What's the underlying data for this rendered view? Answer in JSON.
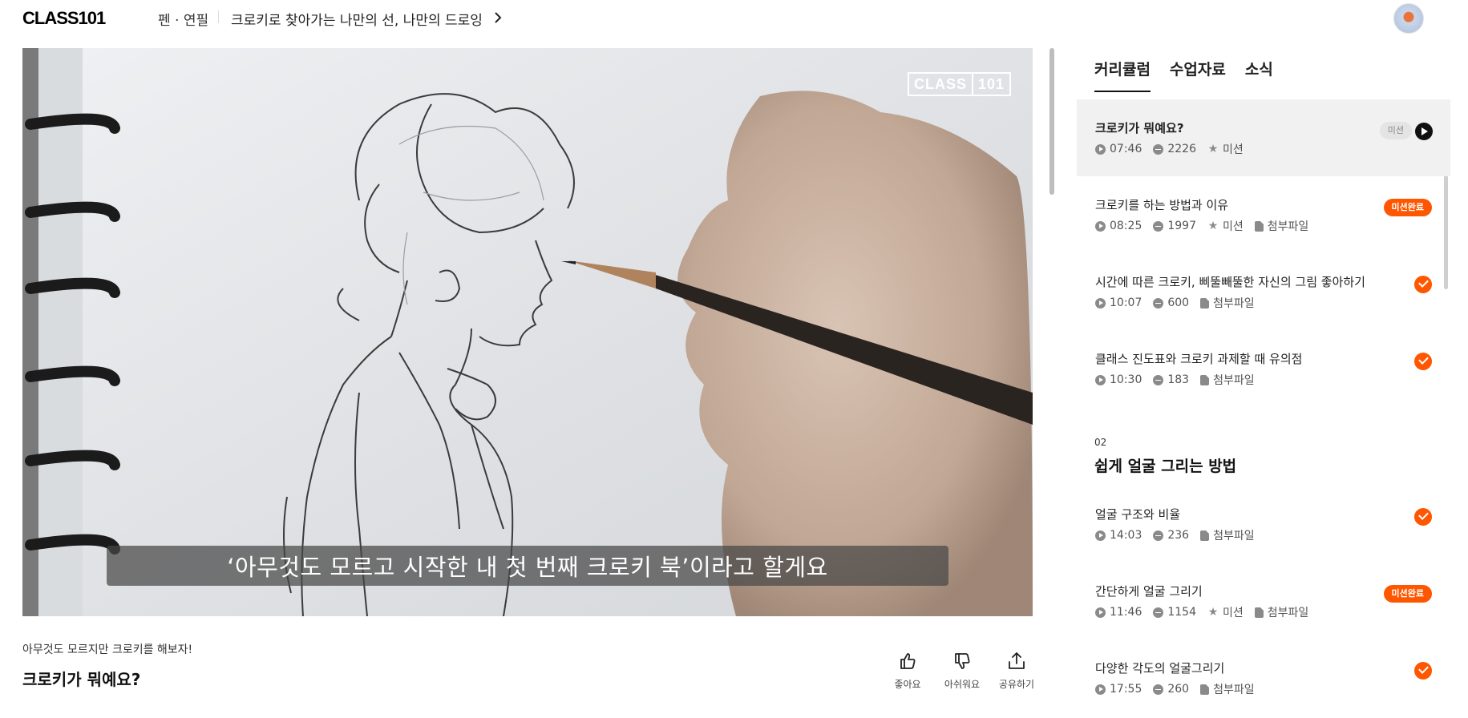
{
  "header": {
    "logo": "CLASS101",
    "category": "펜 · 연필",
    "course_title": "크로키로 찾아가는 나만의 선, 나만의 드로잉"
  },
  "video": {
    "watermark_left": "CLASS",
    "watermark_right": "101",
    "subtitle": "‘아무것도 모르고 시작한 내 첫 번째 크로키 북’이라고 할게요"
  },
  "lesson": {
    "course_subtitle": "아무것도 모르지만 크로키를 해보자!",
    "title": "크로키가 뭐예요?",
    "actions": {
      "like": "좋아요",
      "dislike": "아쉬워요",
      "share": "공유하기"
    }
  },
  "panel": {
    "tabs": [
      "커리큘럼",
      "수업자료",
      "소식"
    ],
    "section_number": "02",
    "section_title": "쉽게 얼굴 그리는 방법",
    "items": [
      {
        "title": "크로키가 뭐예요?",
        "duration": "07:46",
        "comments": "2226",
        "mission": "미션",
        "attachment": "",
        "status": "current",
        "badge": "미션"
      },
      {
        "title": "크로키를 하는 방법과 이유",
        "duration": "08:25",
        "comments": "1997",
        "mission": "미션",
        "attachment": "첨부파일",
        "status": "badge",
        "badge": "미션완료"
      },
      {
        "title": "시간에 따른 크로키, 삐뚤빼뚤한 자신의 그림 좋아하기",
        "duration": "10:07",
        "comments": "600",
        "mission": "",
        "attachment": "첨부파일",
        "status": "done",
        "badge": ""
      },
      {
        "title": "클래스 진도표와 크로키 과제할 때 유의점",
        "duration": "10:30",
        "comments": "183",
        "mission": "",
        "attachment": "첨부파일",
        "status": "done",
        "badge": ""
      },
      {
        "title": "얼굴 구조와 비율",
        "duration": "14:03",
        "comments": "236",
        "mission": "",
        "attachment": "첨부파일",
        "status": "done",
        "badge": ""
      },
      {
        "title": "간단하게 얼굴 그리기",
        "duration": "11:46",
        "comments": "1154",
        "mission": "미션",
        "attachment": "첨부파일",
        "status": "badge",
        "badge": "미션완료"
      },
      {
        "title": "다양한 각도의 얼굴그리기",
        "duration": "17:55",
        "comments": "260",
        "mission": "",
        "attachment": "첨부파일",
        "status": "done",
        "badge": ""
      }
    ]
  },
  "colors": {
    "accent": "#ff5600",
    "current_bg": "#f1f1f1"
  }
}
